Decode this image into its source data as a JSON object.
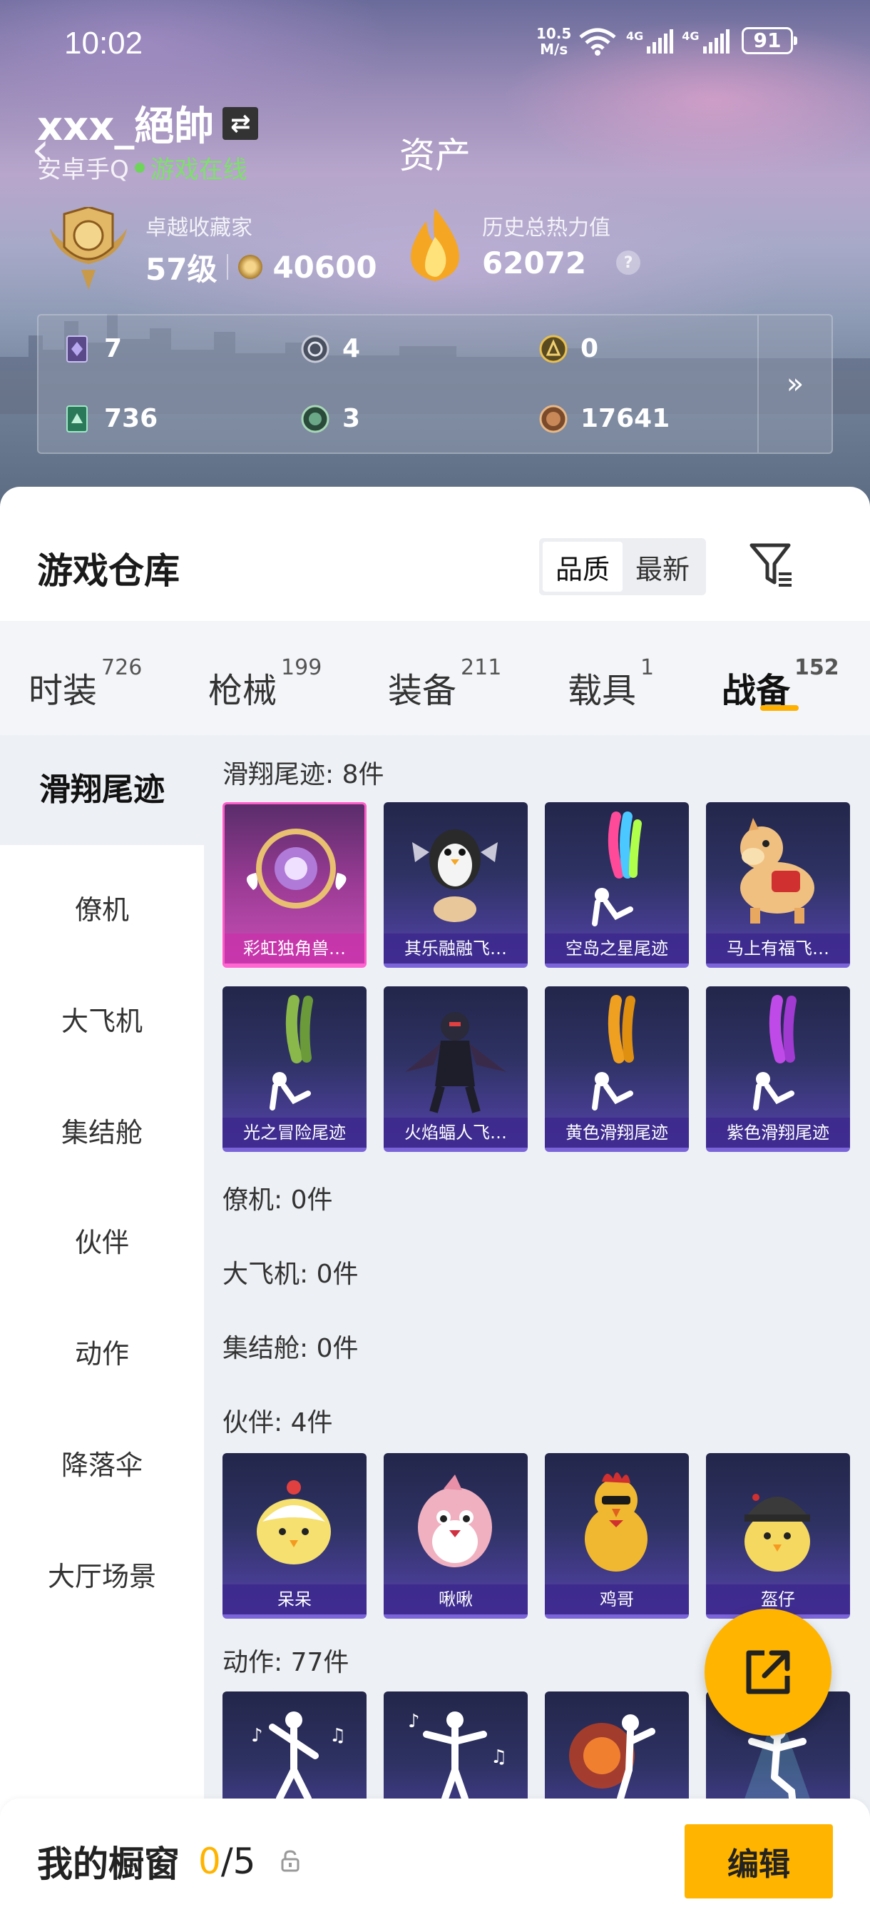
{
  "status_bar": {
    "time": "10:02",
    "speed_value": "10.5",
    "speed_unit": "M/s",
    "signal1": "4G",
    "signal2": "4G",
    "battery": "91"
  },
  "header": {
    "title": "资产",
    "username": "xxx_絕帥",
    "platform": "安卓手Q",
    "online_status": "游戏在线",
    "collector_label": "卓越收藏家",
    "collector_level": "57级",
    "collector_points": "40600",
    "heat_label": "历史总热力值",
    "heat_value": "62072",
    "help": "?"
  },
  "currencies": [
    {
      "icon": "purple-card-icon",
      "value": "7"
    },
    {
      "icon": "silver-coin-icon",
      "value": "4"
    },
    {
      "icon": "gold-badge-icon",
      "value": "0"
    },
    {
      "icon": "green-card-icon",
      "value": "736"
    },
    {
      "icon": "green-coin-icon",
      "value": "3"
    },
    {
      "icon": "bronze-coin-icon",
      "value": "17641"
    }
  ],
  "panel": {
    "title": "游戏仓库",
    "sort_quality": "品质",
    "sort_latest": "最新"
  },
  "tabs": [
    {
      "label": "时装",
      "count": "726"
    },
    {
      "label": "枪械",
      "count": "199"
    },
    {
      "label": "装备",
      "count": "211"
    },
    {
      "label": "载具",
      "count": "1"
    },
    {
      "label": "战备",
      "count": "152",
      "active": true
    }
  ],
  "sidebar": [
    "滑翔尾迹",
    "僚机",
    "大飞机",
    "集结舱",
    "伙伴",
    "动作",
    "降落伞",
    "大厅场景"
  ],
  "sections": {
    "trail": {
      "title": "滑翔尾迹: 8件",
      "items": [
        "彩虹独角兽…",
        "其乐融融飞…",
        "空岛之星尾迹",
        "马上有福飞…",
        "光之冒险尾迹",
        "火焰蝠人飞…",
        "黄色滑翔尾迹",
        "紫色滑翔尾迹"
      ]
    },
    "wingman": {
      "title": "僚机: 0件"
    },
    "plane": {
      "title": "大飞机: 0件"
    },
    "pod": {
      "title": "集结舱: 0件"
    },
    "partner": {
      "title": "伙伴: 4件",
      "items": [
        "呆呆",
        "啾啾",
        "鸡哥",
        "盔仔"
      ]
    },
    "emote": {
      "title": "动作: 77件"
    }
  },
  "bottom": {
    "showcase_label": "我的橱窗",
    "showcase_current": "0",
    "showcase_total": "/5",
    "edit_label": "编辑"
  },
  "colors": {
    "accent": "#ffb400",
    "online": "#6ed45a",
    "card_purple": "#453c8e",
    "card_pink": "#c94fb6"
  }
}
